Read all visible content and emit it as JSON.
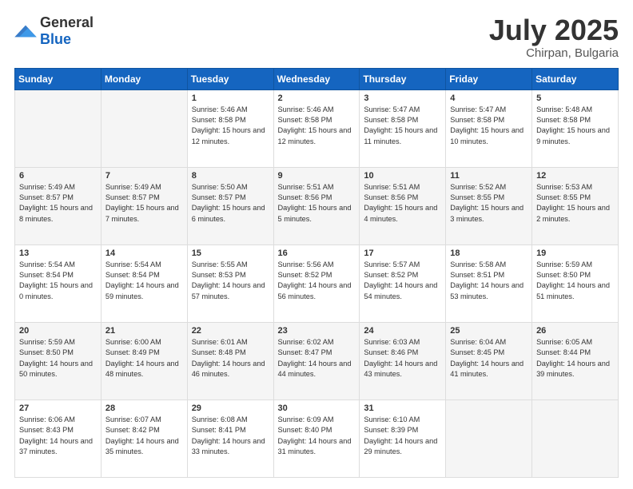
{
  "header": {
    "logo_general": "General",
    "logo_blue": "Blue",
    "title": "July 2025",
    "location": "Chirpan, Bulgaria"
  },
  "weekdays": [
    "Sunday",
    "Monday",
    "Tuesday",
    "Wednesday",
    "Thursday",
    "Friday",
    "Saturday"
  ],
  "weeks": [
    [
      {
        "day": "",
        "empty": true
      },
      {
        "day": "",
        "empty": true
      },
      {
        "day": "1",
        "sunrise": "5:46 AM",
        "sunset": "8:58 PM",
        "daylight": "15 hours and 12 minutes."
      },
      {
        "day": "2",
        "sunrise": "5:46 AM",
        "sunset": "8:58 PM",
        "daylight": "15 hours and 12 minutes."
      },
      {
        "day": "3",
        "sunrise": "5:47 AM",
        "sunset": "8:58 PM",
        "daylight": "15 hours and 11 minutes."
      },
      {
        "day": "4",
        "sunrise": "5:47 AM",
        "sunset": "8:58 PM",
        "daylight": "15 hours and 10 minutes."
      },
      {
        "day": "5",
        "sunrise": "5:48 AM",
        "sunset": "8:58 PM",
        "daylight": "15 hours and 9 minutes."
      }
    ],
    [
      {
        "day": "6",
        "sunrise": "5:49 AM",
        "sunset": "8:57 PM",
        "daylight": "15 hours and 8 minutes."
      },
      {
        "day": "7",
        "sunrise": "5:49 AM",
        "sunset": "8:57 PM",
        "daylight": "15 hours and 7 minutes."
      },
      {
        "day": "8",
        "sunrise": "5:50 AM",
        "sunset": "8:57 PM",
        "daylight": "15 hours and 6 minutes."
      },
      {
        "day": "9",
        "sunrise": "5:51 AM",
        "sunset": "8:56 PM",
        "daylight": "15 hours and 5 minutes."
      },
      {
        "day": "10",
        "sunrise": "5:51 AM",
        "sunset": "8:56 PM",
        "daylight": "15 hours and 4 minutes."
      },
      {
        "day": "11",
        "sunrise": "5:52 AM",
        "sunset": "8:55 PM",
        "daylight": "15 hours and 3 minutes."
      },
      {
        "day": "12",
        "sunrise": "5:53 AM",
        "sunset": "8:55 PM",
        "daylight": "15 hours and 2 minutes."
      }
    ],
    [
      {
        "day": "13",
        "sunrise": "5:54 AM",
        "sunset": "8:54 PM",
        "daylight": "15 hours and 0 minutes."
      },
      {
        "day": "14",
        "sunrise": "5:54 AM",
        "sunset": "8:54 PM",
        "daylight": "14 hours and 59 minutes."
      },
      {
        "day": "15",
        "sunrise": "5:55 AM",
        "sunset": "8:53 PM",
        "daylight": "14 hours and 57 minutes."
      },
      {
        "day": "16",
        "sunrise": "5:56 AM",
        "sunset": "8:52 PM",
        "daylight": "14 hours and 56 minutes."
      },
      {
        "day": "17",
        "sunrise": "5:57 AM",
        "sunset": "8:52 PM",
        "daylight": "14 hours and 54 minutes."
      },
      {
        "day": "18",
        "sunrise": "5:58 AM",
        "sunset": "8:51 PM",
        "daylight": "14 hours and 53 minutes."
      },
      {
        "day": "19",
        "sunrise": "5:59 AM",
        "sunset": "8:50 PM",
        "daylight": "14 hours and 51 minutes."
      }
    ],
    [
      {
        "day": "20",
        "sunrise": "5:59 AM",
        "sunset": "8:50 PM",
        "daylight": "14 hours and 50 minutes."
      },
      {
        "day": "21",
        "sunrise": "6:00 AM",
        "sunset": "8:49 PM",
        "daylight": "14 hours and 48 minutes."
      },
      {
        "day": "22",
        "sunrise": "6:01 AM",
        "sunset": "8:48 PM",
        "daylight": "14 hours and 46 minutes."
      },
      {
        "day": "23",
        "sunrise": "6:02 AM",
        "sunset": "8:47 PM",
        "daylight": "14 hours and 44 minutes."
      },
      {
        "day": "24",
        "sunrise": "6:03 AM",
        "sunset": "8:46 PM",
        "daylight": "14 hours and 43 minutes."
      },
      {
        "day": "25",
        "sunrise": "6:04 AM",
        "sunset": "8:45 PM",
        "daylight": "14 hours and 41 minutes."
      },
      {
        "day": "26",
        "sunrise": "6:05 AM",
        "sunset": "8:44 PM",
        "daylight": "14 hours and 39 minutes."
      }
    ],
    [
      {
        "day": "27",
        "sunrise": "6:06 AM",
        "sunset": "8:43 PM",
        "daylight": "14 hours and 37 minutes."
      },
      {
        "day": "28",
        "sunrise": "6:07 AM",
        "sunset": "8:42 PM",
        "daylight": "14 hours and 35 minutes."
      },
      {
        "day": "29",
        "sunrise": "6:08 AM",
        "sunset": "8:41 PM",
        "daylight": "14 hours and 33 minutes."
      },
      {
        "day": "30",
        "sunrise": "6:09 AM",
        "sunset": "8:40 PM",
        "daylight": "14 hours and 31 minutes."
      },
      {
        "day": "31",
        "sunrise": "6:10 AM",
        "sunset": "8:39 PM",
        "daylight": "14 hours and 29 minutes."
      },
      {
        "day": "",
        "empty": true
      },
      {
        "day": "",
        "empty": true
      }
    ]
  ]
}
